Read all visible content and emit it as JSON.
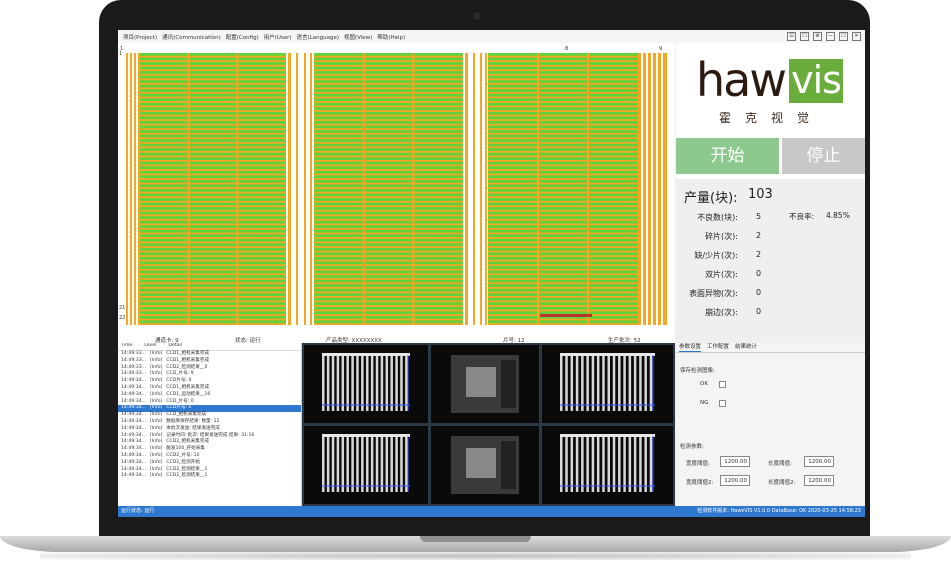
{
  "menu": {
    "items": [
      "项目(Project)",
      "通讯(Communication)",
      "配置(Config)",
      "用户(User)",
      "语言(Language)",
      "视图(View)",
      "帮助(Help)"
    ]
  },
  "window_controls": [
    "⊡",
    "☐",
    "⚙",
    "—",
    "☐",
    "✕"
  ],
  "map": {
    "top_numbers": [
      "1",
      "8",
      "9"
    ],
    "left_numbers": [
      "1",
      "21",
      "22"
    ],
    "colors": {
      "cell": "#5fd23c",
      "gap": "#f5a623",
      "defect": "#b83232"
    }
  },
  "status_row": {
    "items": [
      "通道卡: 9",
      "状态: 运行",
      "产品类型: XXXXXXXX",
      "片号: 12",
      "生产批次: 52"
    ]
  },
  "logo": {
    "word": "hawk",
    "badge": "vis",
    "cn": "霍克视觉"
  },
  "buttons": {
    "start": "开始",
    "stop": "停止"
  },
  "stats": {
    "production_label": "产量(块):",
    "production_value": "103",
    "rows": [
      {
        "label": "不良数(块):",
        "value": "5"
      },
      {
        "label": "碎片(次):",
        "value": "2"
      },
      {
        "label": "缺/少片(次):",
        "value": "2"
      },
      {
        "label": "双片(次):",
        "value": "0"
      },
      {
        "label": "表面异物(次):",
        "value": "0"
      },
      {
        "label": "崩边(次):",
        "value": "0"
      }
    ],
    "rate_label": "不良率:",
    "rate_value": "4.85%"
  },
  "log": {
    "headers": [
      "Time",
      "Level",
      "Detail"
    ],
    "rows": [
      {
        "time": "14:49:33...",
        "level": "[Info]",
        "detail": "CCD1_相机采集完成",
        "selected": false
      },
      {
        "time": "14:49:33...",
        "level": "[Info]",
        "detail": "CCD1_相机采集完成",
        "selected": false
      },
      {
        "time": "14:49:33...",
        "level": "[Info]",
        "detail": "CCD2_检测结果__0",
        "selected": false
      },
      {
        "time": "14:49:33...",
        "level": "[Info]",
        "detail": "CCD_片号: 9",
        "selected": false
      },
      {
        "time": "14:49:34...",
        "level": "[Info]",
        "detail": "CCD片号: 0",
        "selected": false
      },
      {
        "time": "14:49:34...",
        "level": "[Info]",
        "detail": "CCD1_相机采集完成",
        "selected": false
      },
      {
        "time": "14:49:34...",
        "level": "[Info]",
        "detail": "CCD1_运动结果__16",
        "selected": false
      },
      {
        "time": "14:49:34...",
        "level": "[Info]",
        "detail": "CCD_片号: 0",
        "selected": false
      },
      {
        "time": "14:49:34...",
        "level": "[Info]",
        "detail": "CCD片号: 0",
        "selected": true
      },
      {
        "time": "14:49:34...",
        "level": "[Info]",
        "detail": "CCD_相机采集完成",
        "selected": false
      },
      {
        "time": "14:49:34...",
        "level": "[Info]",
        "detail": "数据库保存结果: 数量: 12",
        "selected": false
      },
      {
        "time": "14:49:34...",
        "level": "[Info]",
        "detail": "本批次发送: 结果发送完成",
        "selected": false
      },
      {
        "time": "14:49:34...",
        "level": "[Info]",
        "detail": "记录时间: 批次: 结果发送完成 结果: 31:16",
        "selected": false
      },
      {
        "time": "14:49:34...",
        "level": "[Info]",
        "detail": "CCD2_相机采集完成",
        "selected": false
      },
      {
        "time": "14:49:34...",
        "level": "[Info]",
        "detail": "触发100_开始采集",
        "selected": false
      },
      {
        "time": "14:49:34...",
        "level": "[Info]",
        "detail": "CCD2_片号: 10",
        "selected": false
      },
      {
        "time": "14:49:34...",
        "level": "[Info]",
        "detail": "CCD2_检测开始",
        "selected": false
      },
      {
        "time": "14:49:34...",
        "level": "[Info]",
        "detail": "CCD2_检测结果__1",
        "selected": false
      },
      {
        "time": "14:49:34...",
        "level": "[Info]",
        "detail": "CCD2_检测结果__1",
        "selected": false
      }
    ]
  },
  "settings": {
    "tabs": [
      "参数设置",
      "工作配置",
      "结果统计"
    ],
    "group1_title": "保存检测图像:",
    "opt_ok": "OK",
    "opt_ng": "NG",
    "group2_title": "检测参数:",
    "fields": [
      {
        "label": "宽度阈值:",
        "value": "1200.00"
      },
      {
        "label": "长度阈值:",
        "value": "1200.00"
      },
      {
        "label": "宽度阈值2:",
        "value": "1200.00"
      },
      {
        "label": "长度阈值2:",
        "value": "1200.00"
      }
    ]
  },
  "footer": {
    "left": "运行状态: 运行",
    "right": "检测软件版本: HawkVIS V1.0.0 DataBase: OK   2020-03-25 14:58:23"
  }
}
